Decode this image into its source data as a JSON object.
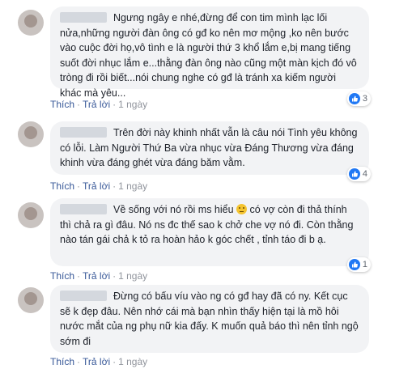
{
  "comments": [
    {
      "text": "Ngưng ngây e nhé,đừng để con tim mình lạc lối nửa,những người đàn ông có gđ ko nên mơ mộng ,ko nên bước vào cuộc đời họ,vô tình e là người thứ 3 khổ lắm e,bị mang tiếng suốt đời nhục lắm e...thằng đàn ông nào cũng một màn kịch đó vô tròng đi rồi biết...nói chung nghe có gđ là tránh xa kiếm người khác mà yêu...",
      "like_label": "Thích",
      "reply_label": "Trả lời",
      "time": "1 ngày",
      "reactions": "3"
    },
    {
      "text": "Trên đời này khinh nhất vẫn là câu nói Tình yêu không có lỗi. Làm Người Thứ Ba vừa nhục vừa Đáng Thương vừa đáng khinh vừa đáng ghét vừa đáng băm vằm.",
      "like_label": "Thích",
      "reply_label": "Trả lời",
      "time": "1 ngày",
      "reactions": "4"
    },
    {
      "text_before": "Về sống với nó rồi ms hiểu",
      "text_after": "có vợ còn đi thả thính thì chả ra gì đâu. Nó ns đc thế sao k chở che vợ nó đi. Còn thằng nào tán gái chả k tỏ ra hoàn hảo k góc chết , tỉnh táo đi b ạ.",
      "emoji": "confused-face-emoji",
      "like_label": "Thích",
      "reply_label": "Trả lời",
      "time": "1 ngày",
      "reactions": "1"
    },
    {
      "text": "Đừng có bấu víu vào ng có gđ hay đã có ny. Kết cục sẽ k đẹp đâu. Nên nhớ cái mà bạn nhìn thấy hiện tại là mồ hôi nước mắt của ng phụ nữ kia đấy. K muốn quả báo thì nên tỉnh ngộ sớm đi",
      "like_label": "Thích",
      "reply_label": "Trả lời",
      "time": "1 ngày"
    }
  ],
  "colors": {
    "bubble": "#f2f3f5",
    "link": "#385898",
    "like": "#2078f4"
  }
}
